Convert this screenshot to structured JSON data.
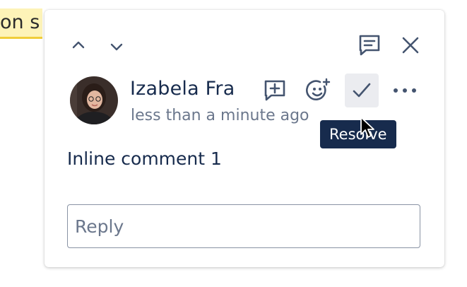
{
  "background": {
    "highlighted_text": "on s"
  },
  "toolbar": {
    "prev_icon": "chevron-up-icon",
    "next_icon": "chevron-down-icon",
    "comments_icon": "comment-lines-icon",
    "close_icon": "close-icon"
  },
  "comment": {
    "author": "Izabela Fra",
    "timestamp": "less than a minute ago",
    "body": "Inline comment 1",
    "actions": {
      "add_inline_icon": "comment-add-icon",
      "reaction_icon": "emoji-add-icon",
      "resolve_icon": "checkmark-icon",
      "more_icon": "more-horizontal-icon"
    },
    "tooltip": "Resolve"
  },
  "reply": {
    "placeholder": "Reply",
    "value": ""
  },
  "colors": {
    "highlight": "#fdf3b8",
    "highlight_underline": "#f0cd3a",
    "text": "#172b4d",
    "subtle_text": "#6b778c",
    "tooltip_bg": "#172b4d"
  }
}
